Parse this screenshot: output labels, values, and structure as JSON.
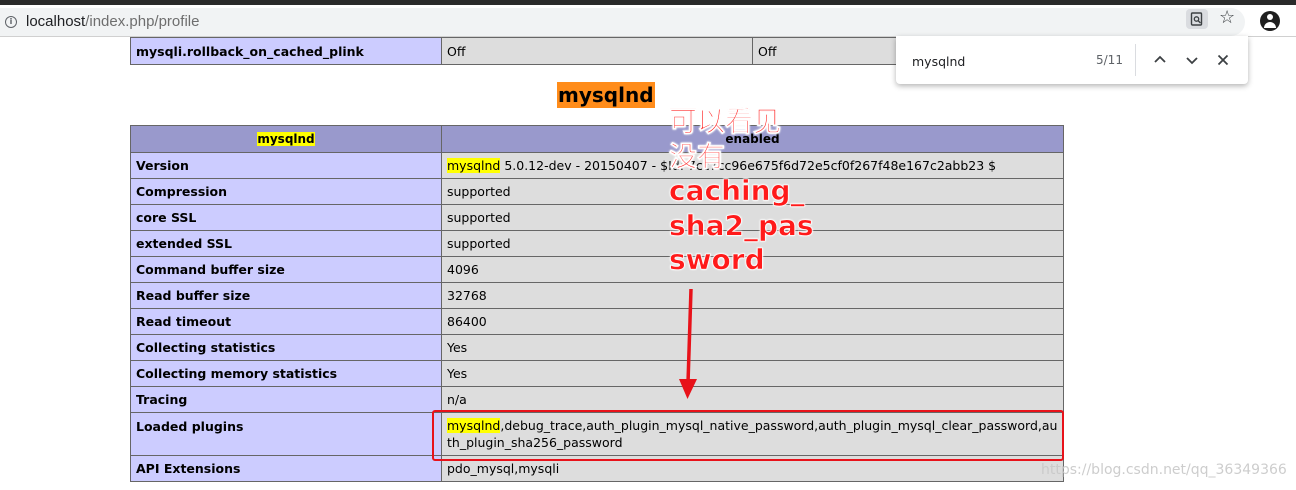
{
  "browser": {
    "url_host": "localhost",
    "url_path": "/index.php/profile",
    "icons": [
      "info-icon",
      "find-in-page-icon",
      "star-icon",
      "account-icon"
    ]
  },
  "find_bar": {
    "query": "mysqlnd",
    "count": "5/11",
    "icons": [
      "chevron-up-icon",
      "chevron-down-icon",
      "close-icon"
    ]
  },
  "top_table": {
    "row": {
      "directive": "mysqli.rollback_on_cached_plink",
      "local": "Off",
      "master": "Off"
    }
  },
  "section_title": "mysqlnd",
  "main_table": {
    "header": {
      "name": "mysqlnd",
      "value": "enabled"
    },
    "rows": [
      {
        "label": "Version",
        "value_highlight": "mysqlnd",
        "value": " 5.0.12-dev - 20150407 - $Id: 7cc7cc96e675f6d72e5cf0f267f48e167c2abb23 $"
      },
      {
        "label": "Compression",
        "value": "supported"
      },
      {
        "label": "core SSL",
        "value": "supported"
      },
      {
        "label": "extended SSL",
        "value": "supported"
      },
      {
        "label": "Command buffer size",
        "value": "4096"
      },
      {
        "label": "Read buffer size",
        "value": "32768"
      },
      {
        "label": "Read timeout",
        "value": "86400"
      },
      {
        "label": "Collecting statistics",
        "value": "Yes"
      },
      {
        "label": "Collecting memory statistics",
        "value": "Yes"
      },
      {
        "label": "Tracing",
        "value": "n/a"
      },
      {
        "label": "Loaded plugins",
        "value_highlight": "mysqlnd",
        "value": ",debug_trace,auth_plugin_mysql_native_password,auth_plugin_mysql_clear_password,auth_plugin_sha256_password"
      },
      {
        "label": "API Extensions",
        "value": "pdo_mysql,mysqli"
      }
    ]
  },
  "annotation": {
    "lines": [
      "可以看见",
      "没有",
      "caching_",
      "sha2_pas",
      "sword"
    ],
    "color": "#ff1a1a"
  },
  "watermark": "https://blog.csdn.net/qq_36349366",
  "colors": {
    "label_cell": "#ccccff",
    "value_cell": "#dddddd",
    "header_cell": "#9999cc",
    "highlight": "#ffff00",
    "active_highlight": "#ff8c1a"
  }
}
